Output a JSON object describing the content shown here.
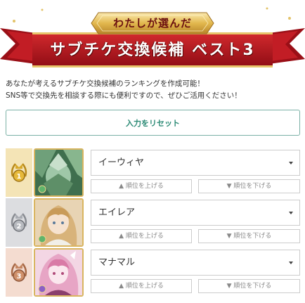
{
  "banner": {
    "subtitle": "わたしが選んだ",
    "title": "サブチケ交換候補 ベスト3"
  },
  "description": {
    "line1": "あなたが考えるサブチケ交換候補のランキングを作成可能！",
    "line2": "SNS等で交換先を相談する際にも便利ですので、ぜひご活用ください！"
  },
  "reset_label": "入力をリセット",
  "ranking": [
    {
      "rank": "1",
      "character": "イーウィヤ",
      "up_label": "▲ 順位を上げる",
      "down_label": "▼ 順位を下げる",
      "medal": "gold-medal-icon"
    },
    {
      "rank": "2",
      "character": "エイレア",
      "up_label": "▲ 順位を上げる",
      "down_label": "▼ 順位を下げる",
      "medal": "silver-medal-icon"
    },
    {
      "rank": "3",
      "character": "マナマル",
      "up_label": "▲ 順位を上げる",
      "down_label": "▼ 順位を下げる",
      "medal": "bronze-medal-icon"
    }
  ],
  "colors": {
    "banner_red": "#b3121e",
    "accent_green": "#2d8b76",
    "gold": "#d9b560"
  }
}
